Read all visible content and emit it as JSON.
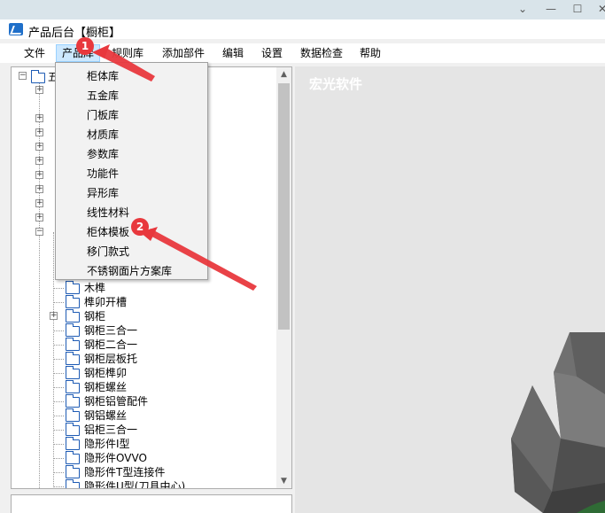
{
  "window": {
    "title": "产品后台【橱柜】",
    "controls": {
      "minimize": "—",
      "maximize": "☐",
      "close": "✕",
      "collapse": "⌄"
    }
  },
  "menubar": {
    "items": [
      "文件",
      "产品库",
      "规则库",
      "添加部件",
      "编辑",
      "设置",
      "数据检查",
      "帮助"
    ]
  },
  "dropdown": {
    "items": [
      "柜体库",
      "五金库",
      "门板库",
      "材质库",
      "参数库",
      "功能件",
      "异形库",
      "线性材料",
      "柜体模板",
      "移门款式",
      "不锈钢面片方案库"
    ]
  },
  "tree": {
    "root_fragment": "五",
    "items": [
      "木榫",
      "榫卯开槽",
      "钢柜",
      "钢柜三合一",
      "钢柜二合一",
      "钢柜层板托",
      "钢柜榫卯",
      "钢柜螺丝",
      "钢柜铝管配件",
      "钢铝螺丝",
      "铝柜三合一",
      "隐形件I型",
      "隐形件OVVO",
      "隐形件T型连接件",
      "隐形件U型(刀具中心)"
    ]
  },
  "viewport": {
    "brand": "宏光软件"
  },
  "annotations": {
    "badge_1": "1",
    "badge_2": "2"
  },
  "colors": {
    "accent_red": "#e8383d",
    "menu_highlight": "#cce8ff",
    "folder_blue": "#1e5bb4"
  }
}
